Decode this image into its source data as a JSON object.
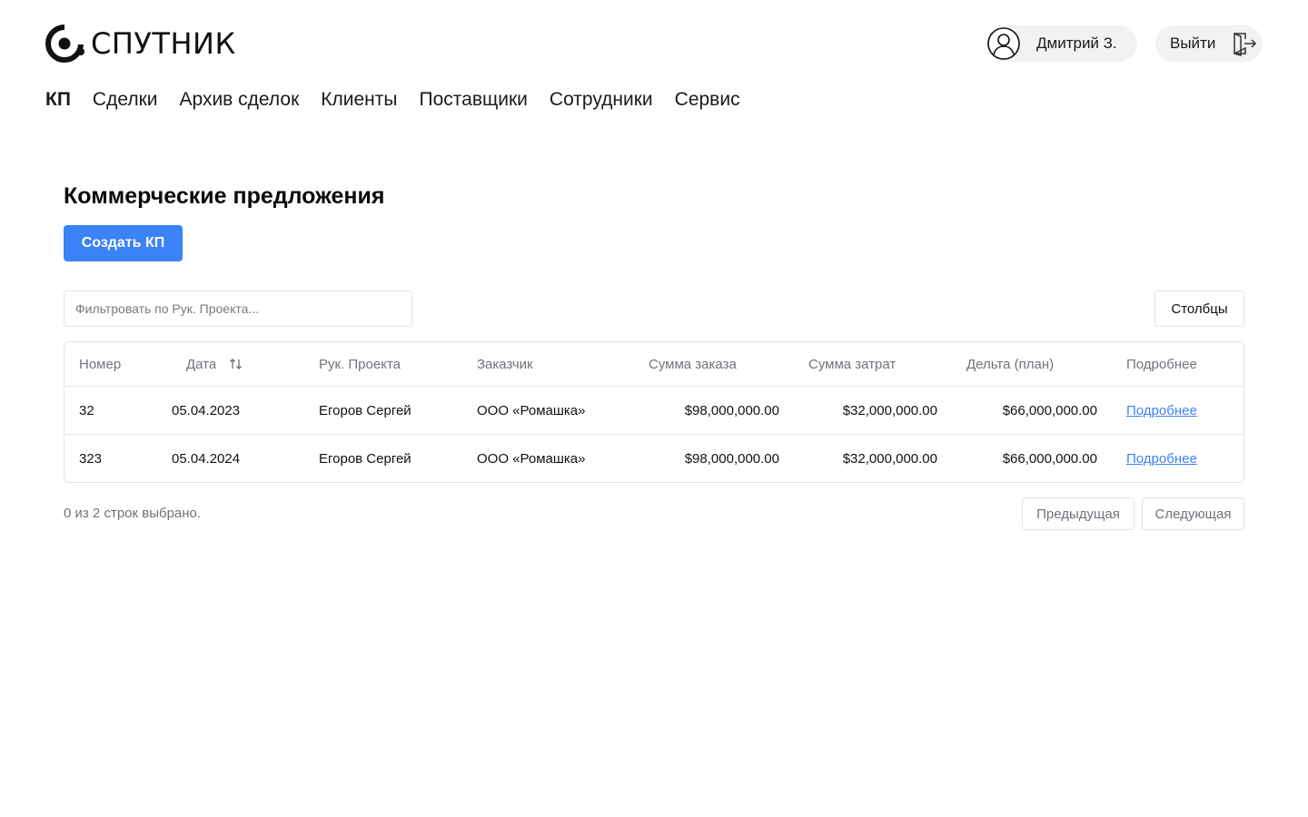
{
  "header": {
    "logo_text": "СПУТНИК",
    "user_name": "Дмитрий З.",
    "logout_label": "Выйти"
  },
  "nav": {
    "items": [
      "КП",
      "Сделки",
      "Архив сделок",
      "Клиенты",
      "Поставщики",
      "Сотрудники",
      "Сервис"
    ],
    "active": "КП"
  },
  "main": {
    "title": "Коммерческие предложения",
    "create_label": "Создать КП",
    "filter_placeholder": "Фильтровать по Рук. Проекта...",
    "columns_label": "Столбцы"
  },
  "table": {
    "headers": [
      "Номер",
      "Дата",
      "Рук. Проекта",
      "Заказчик",
      "Сумма заказа",
      "Сумма затрат",
      "Дельта (план)",
      "Подробнее"
    ],
    "rows": [
      [
        "32",
        "05.04.2023",
        "Егоров Сергей",
        "ООО «Ромашка»",
        "$98,000,000.00",
        "$32,000,000.00",
        "$66,000,000.00",
        "Подробнее"
      ],
      [
        "323",
        "05.04.2024",
        "Егоров Сергей",
        "ООО «Ромашка»",
        "$98,000,000.00",
        "$32,000,000.00",
        "$66,000,000.00",
        "Подробнее"
      ]
    ]
  },
  "footer": {
    "status": "0 из 2 строк выбрано.",
    "prev_label": "Предыдущая",
    "next_label": "Следующая"
  },
  "colors": {
    "accent": "#3b82f6",
    "muted": "#71717a",
    "border": "#e4e4e7",
    "pill_bg": "#f2f2f2"
  },
  "icons": {
    "logo": "sputnik-logo-icon",
    "user": "user-avatar-icon",
    "logout": "logout-door-icon",
    "sort": "sort-arrows-icon"
  }
}
